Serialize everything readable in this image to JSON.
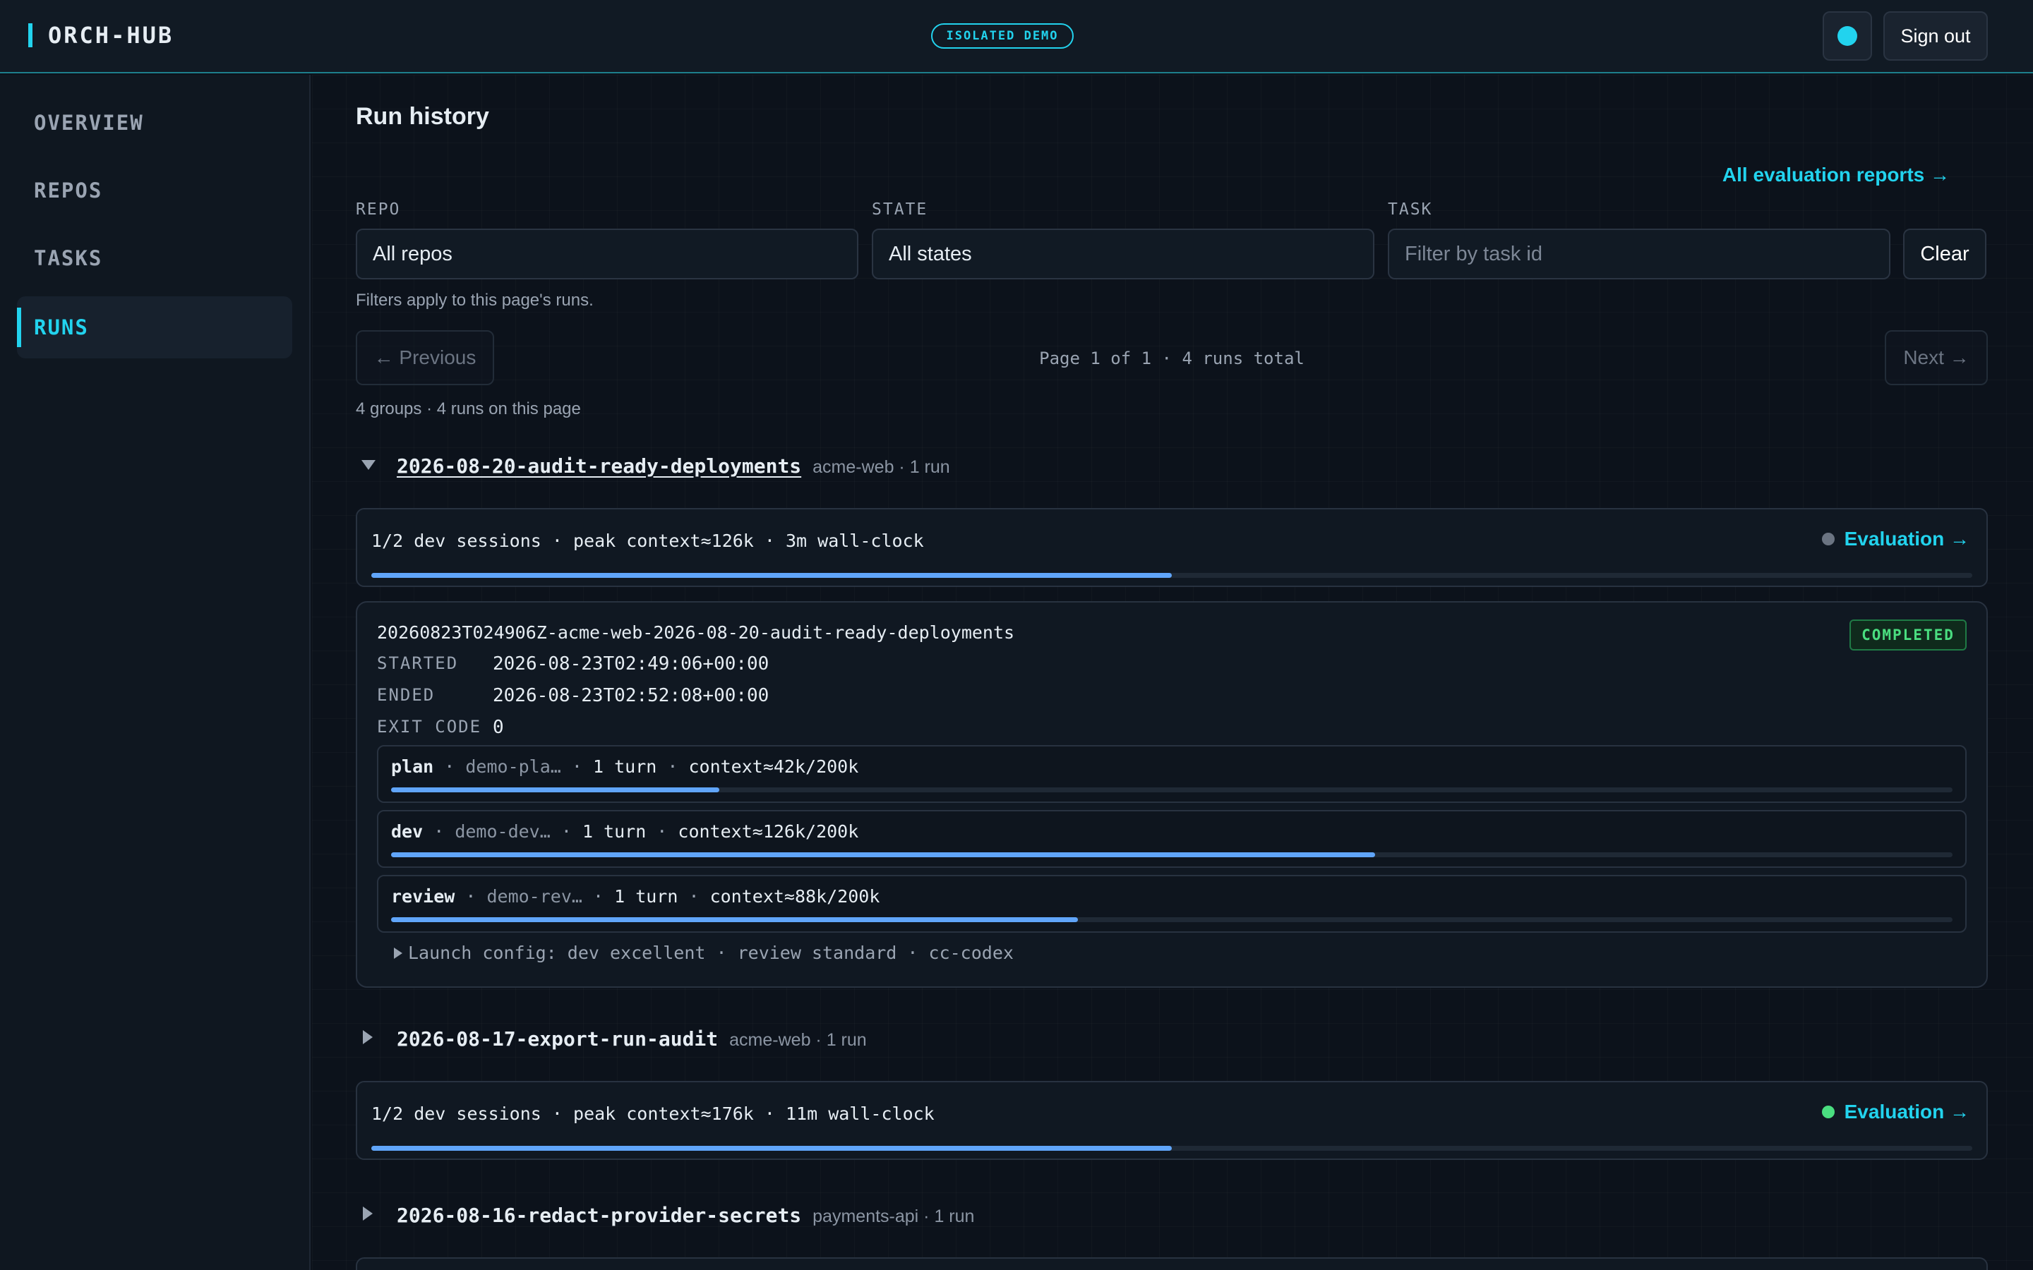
{
  "header": {
    "brand": "ORCH-HUB",
    "badge": "ISOLATED DEMO",
    "signout_label": "Sign out"
  },
  "sidebar": {
    "items": [
      {
        "label": "OVERVIEW",
        "active": false
      },
      {
        "label": "REPOS",
        "active": false
      },
      {
        "label": "TASKS",
        "active": false
      },
      {
        "label": "RUNS",
        "active": true
      }
    ]
  },
  "main": {
    "title": "Run history",
    "eval_reports_link": "All evaluation reports →",
    "filters": {
      "repo": {
        "label": "REPO",
        "value": "All repos"
      },
      "state": {
        "label": "STATE",
        "value": "All states"
      },
      "task": {
        "label": "TASK",
        "placeholder": "Filter by task id"
      },
      "clear_label": "Clear",
      "note": "Filters apply to this page's runs."
    },
    "pagination": {
      "prev_label": "← Previous",
      "next_label": "Next →",
      "info": "Page 1 of 1 · 4 runs total"
    },
    "groups_summary": "4 groups · 4 runs on this page",
    "groups": [
      {
        "name": "2026-08-20-audit-ready-deployments",
        "meta": "acme-web · 1 run",
        "expanded": true,
        "summary": "1/2 dev sessions · peak context≈126k · 3m wall-clock",
        "summary_progress": 0.5,
        "eval_label": "Evaluation →",
        "eval_dot_color": "#6b7482",
        "run": {
          "id": "20260823T024906Z-acme-web-2026-08-20-audit-ready-deployments",
          "status": "COMPLETED",
          "started_label": "STARTED",
          "started": "2026-08-23T02:49:06+00:00",
          "ended_label": "ENDED",
          "ended": "2026-08-23T02:52:08+00:00",
          "exit_code_label": "EXIT CODE",
          "exit_code": "0",
          "sessions": [
            {
              "role": "plan",
              "model": "demo-pla…",
              "turns": "1 turn",
              "context": "context≈42k/200k",
              "fill": 0.21
            },
            {
              "role": "dev",
              "model": "demo-dev…",
              "turns": "1 turn",
              "context": "context≈126k/200k",
              "fill": 0.63
            },
            {
              "role": "review",
              "model": "demo-rev…",
              "turns": "1 turn",
              "context": "context≈88k/200k",
              "fill": 0.44
            }
          ],
          "launch_config": "Launch config: dev excellent · review standard · cc-codex"
        }
      },
      {
        "name": "2026-08-17-export-run-audit",
        "meta": "acme-web · 1 run",
        "expanded": false,
        "summary": "1/2 dev sessions · peak context≈176k · 11m wall-clock",
        "summary_progress": 0.5,
        "eval_label": "Evaluation →",
        "eval_dot_color": "#4ade80"
      },
      {
        "name": "2026-08-16-redact-provider-secrets",
        "meta": "payments-api · 1 run",
        "expanded": false
      }
    ]
  },
  "colors": {
    "accent": "#22d3ee",
    "progress": "#60a5fa",
    "success": "#4ade80"
  }
}
